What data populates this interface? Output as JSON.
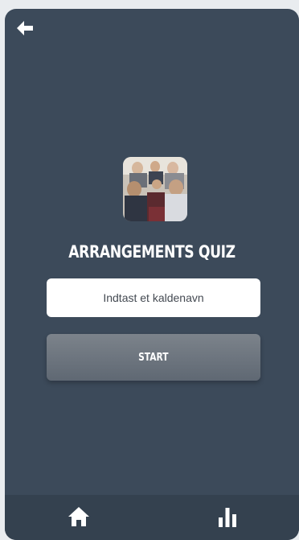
{
  "header": {
    "back_icon": "arrow-left-icon"
  },
  "quiz": {
    "image": "audience-photo",
    "title": "ARRANGEMENTS QUIZ"
  },
  "nickname": {
    "placeholder": "Indtast et kaldenavn",
    "value": ""
  },
  "start_button": {
    "label": "START"
  },
  "bottom_nav": {
    "items": [
      {
        "icon": "home-icon",
        "active": true
      },
      {
        "icon": "bar-chart-icon",
        "active": false
      }
    ]
  },
  "colors": {
    "background": "#3c4a5a",
    "nav_background": "#34414f",
    "button_top": "#7c838b",
    "button_bottom": "#5f6873",
    "text": "#ffffff"
  }
}
